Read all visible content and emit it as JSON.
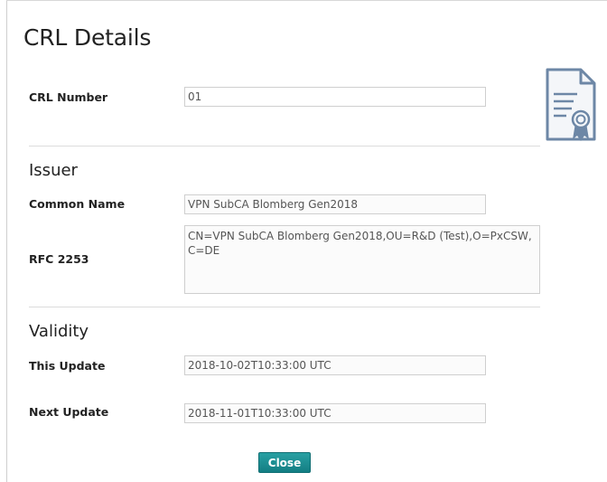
{
  "dialog": {
    "title": "CRL Details",
    "crl_number": {
      "label": "CRL Number",
      "value": "01"
    },
    "issuer": {
      "section_title": "Issuer",
      "common_name": {
        "label": "Common Name",
        "value": "VPN SubCA Blomberg Gen2018"
      },
      "rfc2253": {
        "label": "RFC 2253",
        "value": "CN=VPN SubCA Blomberg Gen2018,OU=R&D (Test),O=PxCSW,C=DE"
      }
    },
    "validity": {
      "section_title": "Validity",
      "this_update": {
        "label": "This Update",
        "value": "2018-10-02T10:33:00 UTC"
      },
      "next_update": {
        "label": "Next Update",
        "value": "2018-11-01T10:33:00 UTC"
      }
    },
    "close_label": "Close",
    "icon": "certificate-icon",
    "colors": {
      "accent": "#1a8a8e",
      "icon": "#6d87a6"
    }
  }
}
